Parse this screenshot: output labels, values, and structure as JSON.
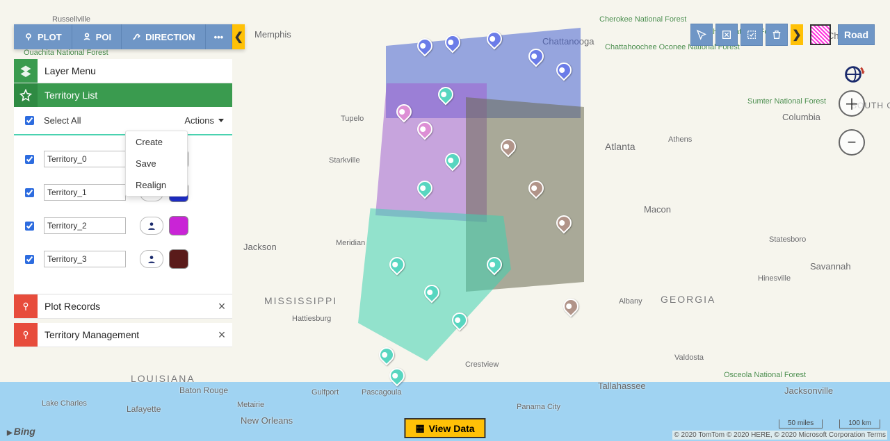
{
  "toolbar": {
    "plot": "PLOT",
    "poi": "POI",
    "direction": "DIRECTION",
    "arrow_collapse": "❮"
  },
  "right_toolbar": {
    "arrow": "❯",
    "road": "Road",
    "icons": [
      "select-tool-icon",
      "box-select-icon",
      "check-select-icon",
      "trash-icon"
    ]
  },
  "zoom": {
    "in": "＋",
    "out": "−"
  },
  "layer_menu": {
    "title": "Layer Menu"
  },
  "territory_list": {
    "title": "Territory List",
    "select_all": "Select All",
    "select_all_checked": true,
    "actions_label": "Actions",
    "actions_menu": [
      "Create",
      "Save",
      "Realign"
    ],
    "items": [
      {
        "checked": true,
        "name": "Territory_0",
        "color": "#4ed2b0"
      },
      {
        "checked": true,
        "name": "Territory_1",
        "color": "#1f2fcf"
      },
      {
        "checked": true,
        "name": "Territory_2",
        "color": "#c924d6"
      },
      {
        "checked": true,
        "name": "Territory_3",
        "color": "#5a1b1a"
      }
    ]
  },
  "collapsed_panels": {
    "plot_records": "Plot Records",
    "territory_mgmt": "Territory Management"
  },
  "view_data": "View Data",
  "attribution": "© 2020 TomTom © 2020 HERE, © 2020 Microsoft Corporation  Terms",
  "scale": {
    "miles": "50 miles",
    "km": "100 km"
  },
  "bing": "Bing",
  "map_labels": {
    "mississippi": "MISSISSIPPI",
    "georgia": "GEORGIA",
    "louisiana": "LOUISIANA",
    "south_carolina": "SOUTH CAROLINA",
    "memphis": "Memphis",
    "tupelo": "Tupelo",
    "starkville": "Starkville",
    "meridian": "Meridian",
    "jackson": "Jackson",
    "hattiesburg": "Hattiesburg",
    "baton_rouge": "Baton Rouge",
    "new_orleans": "New Orleans",
    "lafayette": "Lafayette",
    "lake_charles": "Lake Charles",
    "gulfport": "Gulfport",
    "pascagoula": "Pascagoula",
    "crestview": "Crestview",
    "panama_city": "Panama City",
    "tallahassee": "Tallahassee",
    "valdosta": "Valdosta",
    "jacksonville": "Jacksonville",
    "savannah": "Savannah",
    "hinesville": "Hinesville",
    "statesboro": "Statesboro",
    "macon": "Macon",
    "atlanta": "Atlanta",
    "athens": "Athens",
    "columbia": "Columbia",
    "charlotte": "Charlotte",
    "albany": "Albany",
    "chattanooga": "Chattanooga",
    "russellville": "Russellville",
    "ouachita": "Ouachita National Forest",
    "metairie": "Metairie",
    "cherokee": "Cherokee National Forest",
    "nantahala": "Nantahala National Forest",
    "chatt_oconee": "Chattahoochee Oconee National Forest",
    "sumter": "Sumter National Forest",
    "osceola": "Osceola National Forest"
  }
}
